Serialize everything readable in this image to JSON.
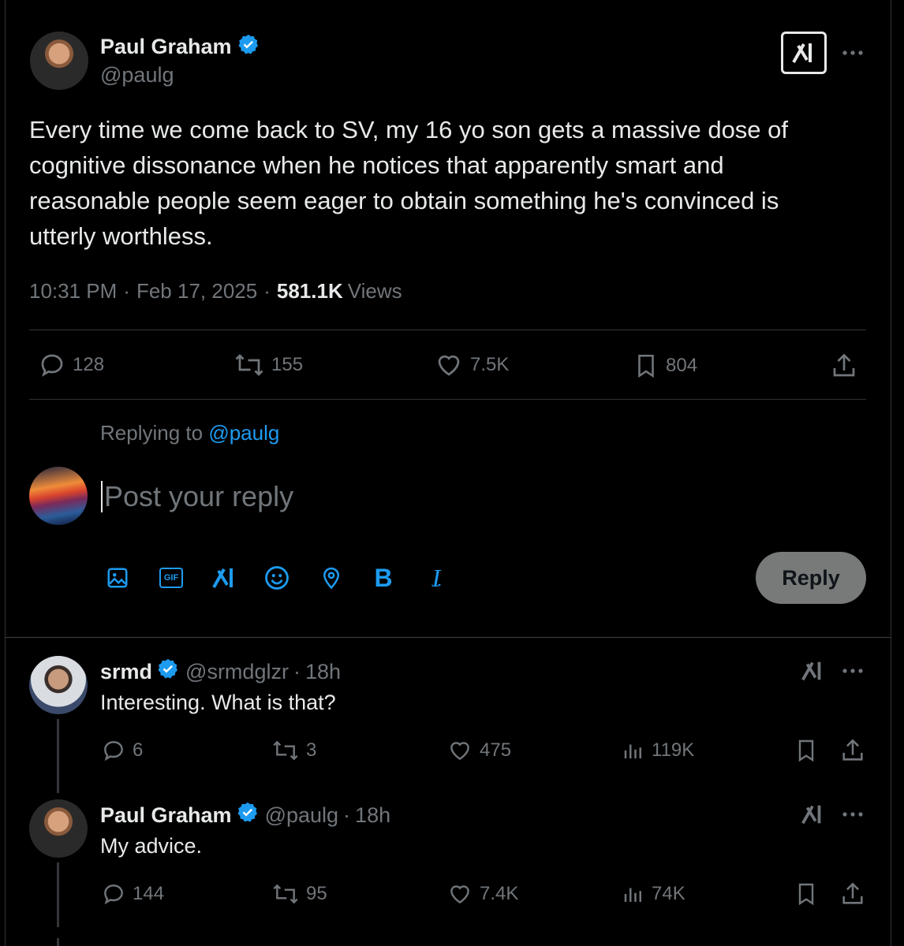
{
  "main_post": {
    "author_name": "Paul Graham",
    "handle": "@paulg",
    "text": "Every time we come back to SV, my 16 yo son gets a massive dose of cognitive dissonance when he notices that apparently smart and reasonable people seem eager to obtain something he's convinced is utterly worthless.",
    "time": "10:31 PM",
    "date": "Feb 17, 2025",
    "views_count": "581.1K",
    "views_label": "Views",
    "replies": "128",
    "reposts": "155",
    "likes": "7.5K",
    "bookmarks": "804"
  },
  "composer": {
    "replying_to_label": "Replying to",
    "replying_to_handle": "@paulg",
    "placeholder": "Post your reply",
    "reply_button": "Reply",
    "bold_label": "B",
    "italic_label": "I",
    "gif_label": "GIF"
  },
  "replies": [
    {
      "author_name": "srmd",
      "handle": "@srmdglzr",
      "time": "18h",
      "text": "Interesting. What is that?",
      "replies": "6",
      "reposts": "3",
      "likes": "475",
      "views": "119K"
    },
    {
      "author_name": "Paul Graham",
      "handle": "@paulg",
      "time": "18h",
      "text": "My advice.",
      "replies": "144",
      "reposts": "95",
      "likes": "7.4K",
      "views": "74K"
    }
  ],
  "colors": {
    "background": "#000000",
    "accent": "#1d9bf0",
    "muted": "#71767b",
    "divider": "#2f3336"
  }
}
